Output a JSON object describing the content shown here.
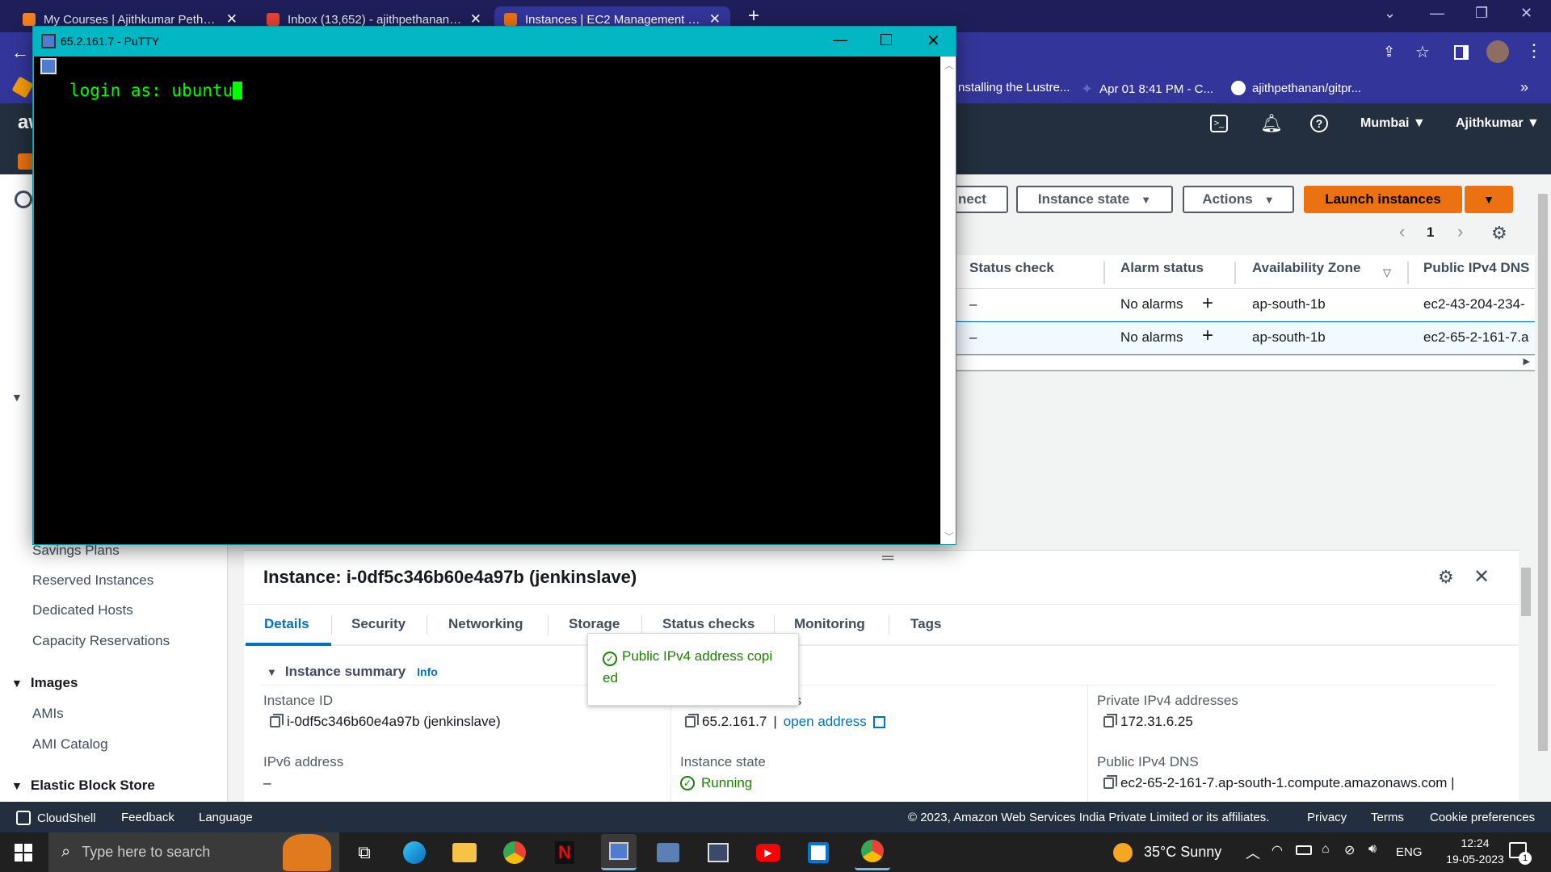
{
  "browser": {
    "tabs": [
      {
        "title": "My Courses | Ajithkumar Pethana",
        "favicon_color": "#f58220"
      },
      {
        "title": "Inbox (13,652) - ajithpethanan19",
        "favicon_color": "#ea4335"
      },
      {
        "title": "Instances | EC2 Management Cor",
        "favicon_color": "#ec7211"
      }
    ],
    "new_tab_label": "+",
    "bookmarks": [
      {
        "label": "nstalling the Lustre..."
      },
      {
        "label": "Apr 01 8:41 PM - C..."
      },
      {
        "label": "ajithpethanan/gitpr..."
      }
    ],
    "bookmarks_overflow": "»"
  },
  "aws_nav": {
    "logo": "aw",
    "region": "Mumbai",
    "user": "Ajithkumar"
  },
  "sidebar": {
    "links_top": [
      "Savings Plans",
      "Reserved Instances",
      "Dedicated Hosts",
      "Capacity Reservations"
    ],
    "images_heading": "Images",
    "images_links": [
      "AMIs",
      "AMI Catalog"
    ],
    "ebs_heading": "Elastic Block Store"
  },
  "toolbar": {
    "connect_label": "nect",
    "instance_state_label": "Instance state",
    "actions_label": "Actions",
    "launch_label": "Launch instances",
    "page_number": "1"
  },
  "table": {
    "headers": [
      "Status check",
      "Alarm status",
      "Availability Zone",
      "Public IPv4 DNS"
    ],
    "rows": [
      {
        "status_check": "–",
        "alarm": "No alarms",
        "az": "ap-south-1b",
        "dns": "ec2-43-204-234-"
      },
      {
        "status_check": "–",
        "alarm": "No alarms",
        "az": "ap-south-1b",
        "dns": "ec2-65-2-161-7.a"
      }
    ]
  },
  "details": {
    "title": "Instance: i-0df5c346b60e4a97b (jenkinslave)",
    "tabs": [
      "Details",
      "Security",
      "Networking",
      "Storage",
      "Status checks",
      "Monitoring",
      "Tags"
    ],
    "active_tab": "Details",
    "summary_heading": "Instance summary",
    "info_label": "Info",
    "instance_id_label": "Instance ID",
    "instance_id_value": "i-0df5c346b60e4a97b (jenkinslave)",
    "public_ipv4_label": "Public IPv4 address",
    "public_ipv4_value": "65.2.161.7",
    "public_ipv4_sep": "|",
    "open_address": "open address",
    "private_ipv4_label": "Private IPv4 addresses",
    "private_ipv4_value": "172.31.6.25",
    "ipv6_label": "IPv6 address",
    "ipv6_value": "–",
    "instance_state_label": "Instance state",
    "instance_state_value": "Running",
    "public_dns_label": "Public IPv4 DNS",
    "public_dns_value": "ec2-65-2-161-7.ap-south-1.compute.amazonaws.com |"
  },
  "toast": {
    "message": "Public IPv4 address copi ed"
  },
  "footer": {
    "cloudshell": "CloudShell",
    "feedback": "Feedback",
    "language": "Language",
    "copyright": "© 2023, Amazon Web Services India Private Limited or its affiliates.",
    "privacy": "Privacy",
    "terms": "Terms",
    "cookies": "Cookie preferences"
  },
  "putty": {
    "title": "65.2.161.7 - PuTTY",
    "terminal_line": "login as: ubuntu"
  },
  "taskbar": {
    "search_placeholder": "Type here to search",
    "weather": "35°C  Sunny",
    "lang": "ENG",
    "time": "12:24",
    "date": "19-05-2023",
    "notification_count": "1"
  }
}
